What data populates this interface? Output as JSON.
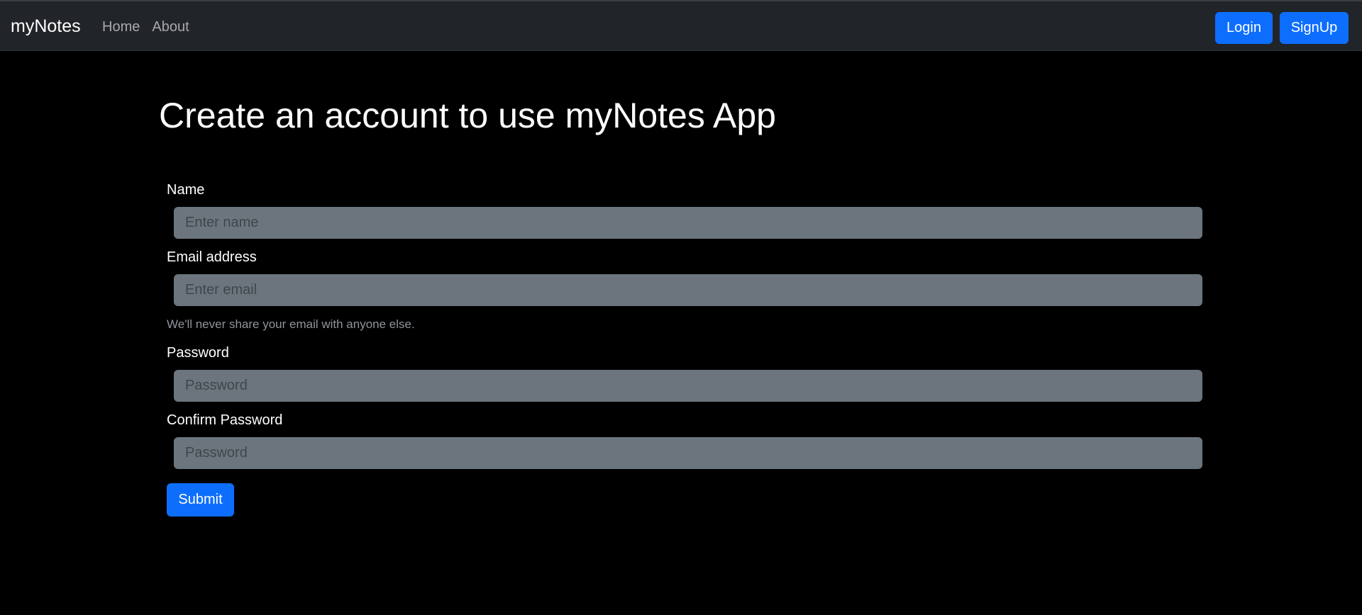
{
  "navbar": {
    "brand": "myNotes",
    "links": [
      "Home",
      "About"
    ],
    "login_label": "Login",
    "signup_label": "SignUp"
  },
  "form": {
    "heading": "Create an account to use myNotes App",
    "name_label": "Name",
    "name_placeholder": "Enter name",
    "email_label": "Email address",
    "email_placeholder": "Enter email",
    "email_help": "We'll never share your email with anyone else.",
    "password_label": "Password",
    "password_placeholder": "Password",
    "confirm_label": "Confirm Password",
    "confirm_placeholder": "Password",
    "submit_label": "Submit"
  },
  "colors": {
    "navbar_bg": "#212529",
    "page_bg": "#000000",
    "primary": "#0d6efd",
    "input_bg": "#6c757d"
  }
}
